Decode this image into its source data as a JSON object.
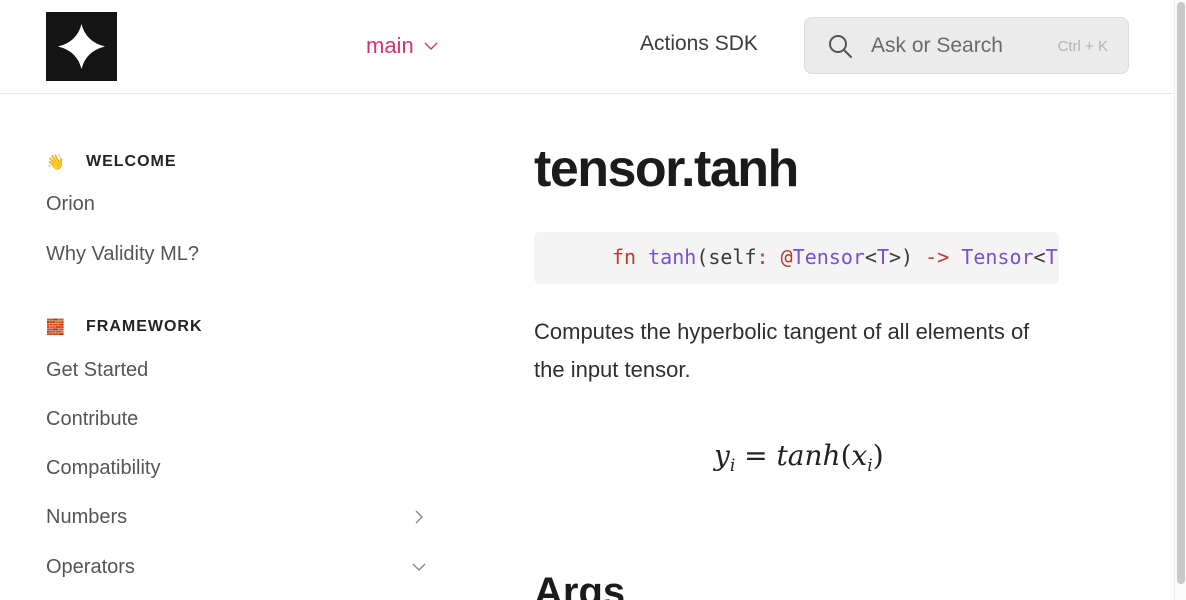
{
  "header": {
    "version_label": "main",
    "nav_link": "Actions SDK",
    "search_placeholder": "Ask or Search",
    "search_shortcut": "Ctrl + K"
  },
  "sidebar": {
    "sections": [
      {
        "title": "WELCOME",
        "emoji": "👋",
        "icon": "waving-hand-icon"
      },
      {
        "title": "FRAMEWORK",
        "emoji": "🧱",
        "icon": "framework-icon"
      }
    ],
    "items": [
      {
        "label": "Orion"
      },
      {
        "label": "Why Validity ML?"
      },
      {
        "label": "Get Started"
      },
      {
        "label": "Contribute"
      },
      {
        "label": "Compatibility"
      },
      {
        "label": "Numbers",
        "chevron": "right"
      },
      {
        "label": "Operators",
        "chevron": "down"
      }
    ]
  },
  "main": {
    "title": "tensor.tanh",
    "code": {
      "kw_fn": "fn",
      "name": "tanh",
      "open": "(self",
      "colon": ":",
      "at": "@",
      "type1": "Tensor",
      "lt1": "<",
      "t1": "T",
      "gt_close": ">)",
      "arrow": "->",
      "type2": "Tensor",
      "lt2": "<",
      "t2": "T"
    },
    "description": "Computes the hyperbolic tangent of all elements of the input tensor.",
    "formula": {
      "lhs": "y",
      "lhs_sub": "i",
      "eq": "=",
      "fn": "tanh",
      "arg": "x",
      "arg_sub": "i"
    },
    "next_heading": "Args"
  },
  "colors": {
    "accent": "#d6336c",
    "keyword": "#c0392b",
    "type": "#7b4fcf"
  }
}
